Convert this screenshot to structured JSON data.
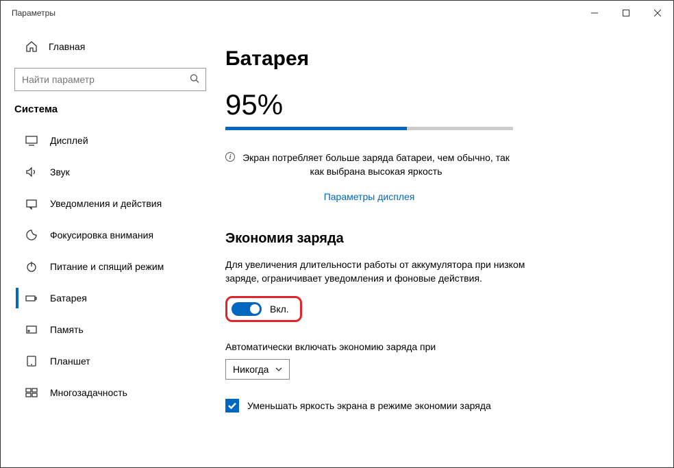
{
  "window": {
    "title": "Параметры"
  },
  "sidebar": {
    "home_label": "Главная",
    "search_placeholder": "Найти параметр",
    "section_title": "Система",
    "items": [
      {
        "label": "Дисплей"
      },
      {
        "label": "Звук"
      },
      {
        "label": "Уведомления и действия"
      },
      {
        "label": "Фокусировка внимания"
      },
      {
        "label": "Питание и спящий режим"
      },
      {
        "label": "Батарея"
      },
      {
        "label": "Память"
      },
      {
        "label": "Планшет"
      },
      {
        "label": "Многозадачность"
      }
    ],
    "active_index": 5
  },
  "main": {
    "title": "Батарея",
    "percent_label": "95%",
    "percent_value": 95,
    "info_text": "Экран потребляет больше заряда батареи, чем обычно, так как выбрана высокая яркость",
    "display_link": "Параметры дисплея",
    "saver": {
      "heading": "Экономия заряда",
      "desc": "Для увеличения длительности работы от аккумулятора при низком заряде, ограничивает уведомления и фоновые действия.",
      "toggle_state": "Вкл.",
      "toggle_on": true,
      "auto_label": "Автоматически включать экономию заряда при",
      "auto_value": "Никогда",
      "brightness_checkbox_label": "Уменьшать яркость экрана в режиме экономии заряда",
      "brightness_checked": true
    }
  }
}
